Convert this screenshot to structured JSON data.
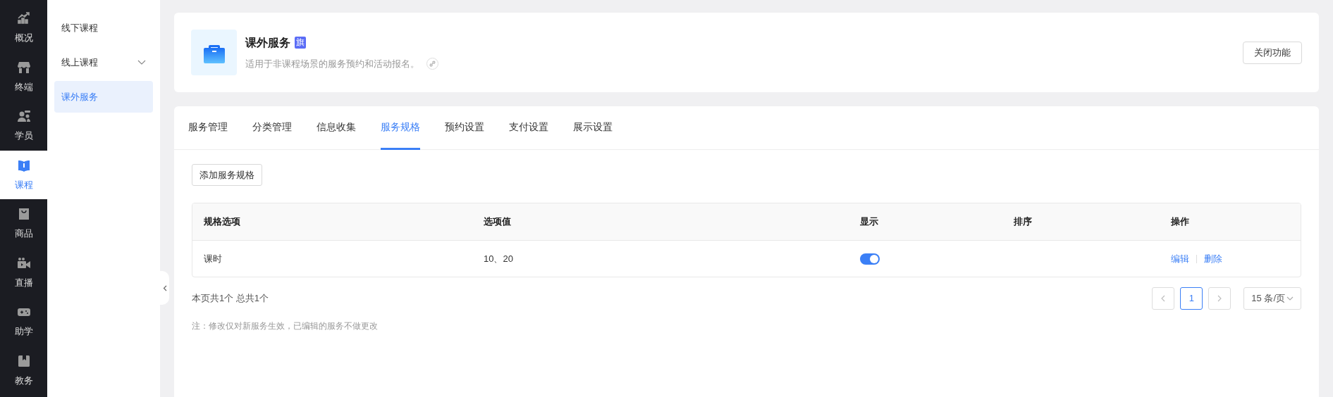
{
  "nav_rail": [
    {
      "label": "概况",
      "selected": false
    },
    {
      "label": "终端",
      "selected": false
    },
    {
      "label": "学员",
      "selected": false
    },
    {
      "label": "课程",
      "selected": true
    },
    {
      "label": "商品",
      "selected": false
    },
    {
      "label": "直播",
      "selected": false
    },
    {
      "label": "助学",
      "selected": false
    },
    {
      "label": "教务",
      "selected": false
    }
  ],
  "sub_menu": [
    {
      "label": "线下课程",
      "expandable": false,
      "selected": false
    },
    {
      "label": "线上课程",
      "expandable": true,
      "selected": false
    },
    {
      "label": "课外服务",
      "expandable": false,
      "selected": true
    }
  ],
  "header": {
    "title": "课外服务",
    "badge": "旗",
    "description": "适用于非课程场景的服务预约和活动报名。",
    "button": "关闭功能"
  },
  "tabs": [
    {
      "label": "服务管理",
      "selected": false
    },
    {
      "label": "分类管理",
      "selected": false
    },
    {
      "label": "信息收集",
      "selected": false
    },
    {
      "label": "服务规格",
      "selected": true
    },
    {
      "label": "预约设置",
      "selected": false
    },
    {
      "label": "支付设置",
      "selected": false
    },
    {
      "label": "展示设置",
      "selected": false
    }
  ],
  "add_button": "添加服务规格",
  "table": {
    "columns": [
      "规格选项",
      "选项值",
      "显示",
      "排序",
      "操作"
    ],
    "rows": [
      {
        "option": "课时",
        "values": "10、20",
        "shown": true,
        "actions": [
          "编辑",
          "删除"
        ]
      }
    ]
  },
  "summary": "本页共1个 总共1个",
  "pagination": {
    "pages": [
      {
        "label": "1",
        "selected": true
      }
    ],
    "page_size": "15 条/页"
  },
  "note": "注：修改仅对新服务生效，已编辑的服务不做更改"
}
